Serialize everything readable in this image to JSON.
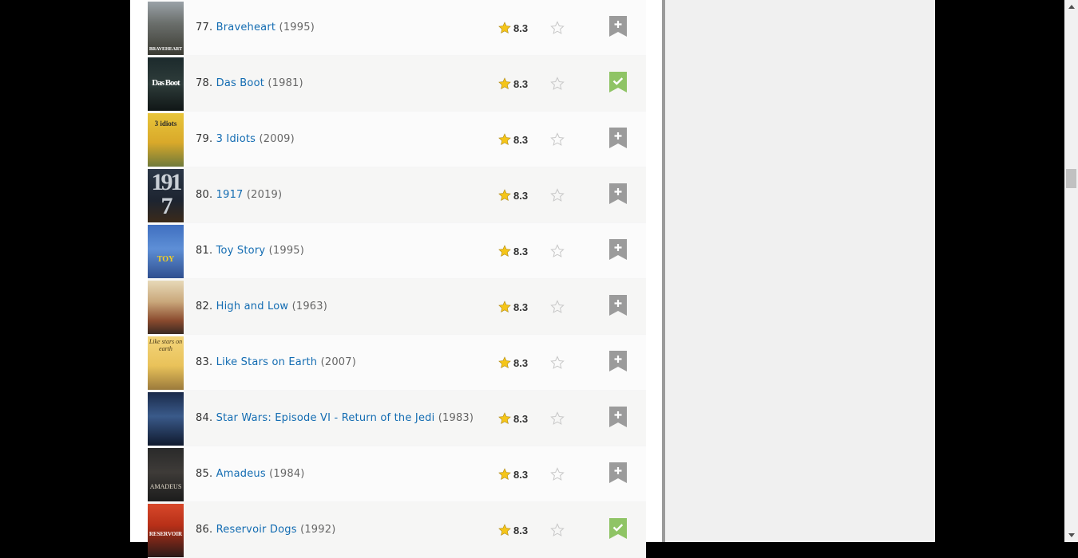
{
  "colors": {
    "link": "#136cb2",
    "rating_star": "#f5c518",
    "watchlist_add": "#9b9b9b",
    "watchlist_added": "#8fc465"
  },
  "movies": [
    {
      "rank": "77.",
      "title": "Braveheart",
      "year": "(1995)",
      "rating": "8.3",
      "in_watchlist": false,
      "poster_text": "BRAVEHEART"
    },
    {
      "rank": "78.",
      "title": "Das Boot",
      "year": "(1981)",
      "rating": "8.3",
      "in_watchlist": true,
      "poster_text": "Das Boot"
    },
    {
      "rank": "79.",
      "title": "3 Idiots",
      "year": "(2009)",
      "rating": "8.3",
      "in_watchlist": false,
      "poster_text": "3 idiots"
    },
    {
      "rank": "80.",
      "title": "1917",
      "year": "(2019)",
      "rating": "8.3",
      "in_watchlist": false,
      "poster_text": "1917"
    },
    {
      "rank": "81.",
      "title": "Toy Story",
      "year": "(1995)",
      "rating": "8.3",
      "in_watchlist": false,
      "poster_text": "TOY"
    },
    {
      "rank": "82.",
      "title": "High and Low",
      "year": "(1963)",
      "rating": "8.3",
      "in_watchlist": false,
      "poster_text": ""
    },
    {
      "rank": "83.",
      "title": "Like Stars on Earth",
      "year": "(2007)",
      "rating": "8.3",
      "in_watchlist": false,
      "poster_text": "Like stars on earth"
    },
    {
      "rank": "84.",
      "title": "Star Wars: Episode VI - Return of the Jedi",
      "year": "(1983)",
      "rating": "8.3",
      "in_watchlist": false,
      "poster_text": ""
    },
    {
      "rank": "85.",
      "title": "Amadeus",
      "year": "(1984)",
      "rating": "8.3",
      "in_watchlist": false,
      "poster_text": "AMADEUS"
    },
    {
      "rank": "86.",
      "title": "Reservoir Dogs",
      "year": "(1992)",
      "rating": "8.3",
      "in_watchlist": true,
      "poster_text": "RESERVOIR"
    }
  ]
}
